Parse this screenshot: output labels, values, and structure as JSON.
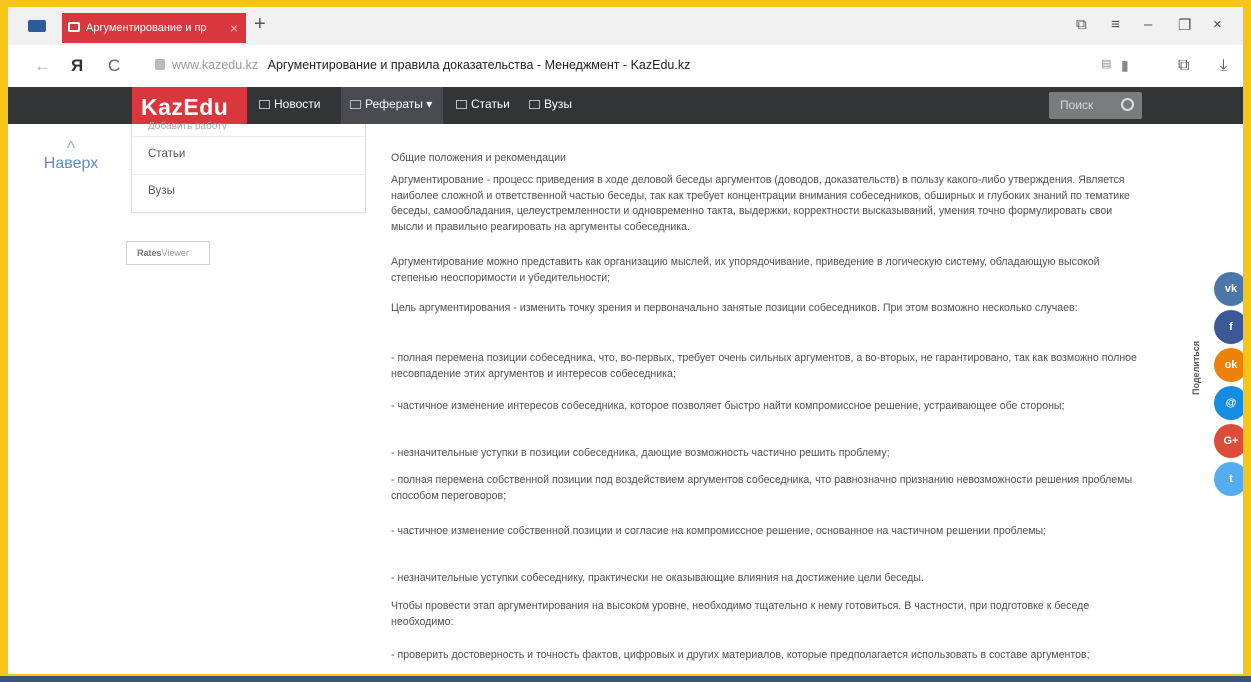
{
  "browser": {
    "tab_title": "Аргументирование и пр",
    "tab_close": "×",
    "new_tab": "+",
    "back": "←",
    "yandex_logo": "Я",
    "reload": "C",
    "url_domain": "www.kazedu.kz",
    "page_title": "Аргументирование и правила доказательства - Менеджмент - KazEdu.kz",
    "window_controls": {
      "minimize": "–",
      "maximize": "❐",
      "close": "×",
      "menu": "≡",
      "bookmarks": "⧉"
    },
    "download": "⤓"
  },
  "site": {
    "logo": "KazEdu",
    "nav": {
      "news": "Новости",
      "essays": "Рефераты ▾",
      "articles": "Статьи",
      "universities": "Вузы"
    },
    "search_placeholder": "Поиск"
  },
  "sidebar": {
    "up_label": "Наверх",
    "up_arrow": "^",
    "cut_item": "Добавить работу",
    "items": [
      {
        "label": "Статьи"
      },
      {
        "label": "Вузы"
      }
    ],
    "widget": {
      "bold": "Rates",
      "rest": "Viewer"
    }
  },
  "article": {
    "paragraphs": [
      "Общие положения и рекомендации",
      "Аргументирование - процесс приведения в ходе деловой беседы аргументов (доводов, доказательств) в пользу какого-либо утверждения. Является наиболее сложной и ответственной частью беседы, так как требует концентрации внимания собеседников, обширных и глубоких знаний по тематике беседы, самообладания, целеустремленности и одновременно такта, выдержки, корректности высказываний, умения точно формулировать свои мысли и правильно реагировать на аргументы собеседника.",
      "Аргументирование можно представить как организацию мыслей, их упорядочивание, приведение в логическую систему, обладающую высокой степенью неоспоримости и убедительности;",
      "Цель аргументирования - изменить точку зрения и первоначально занятые позиции собеседников. При этом возможно несколько случаев:",
      "- полная перемена позиции собеседника, что, во-первых, требует очень сильных аргументов, а во-вторых, не гарантировано, так как возможно полное несовпадение этих аргументов и интересов собеседника;",
      "- частичное изменение интересов собеседника, которое позволяет быстро найти компромиссное решение, устраивающее обе стороны;",
      "- незначительные уступки в позиции собеседника, дающие возможность частично решить проблему;",
      "- полная перемена собственной позиции под воздействием аргументов собеседника, что равнозначно признанию невозможности решения проблемы способом переговоров;",
      "- частичное изменение собственной позиции и согласие на компромиссное решение, основанное на частичном решении проблемы;",
      "- незначительные уступки собеседнику, практически не оказывающие влияния на достижение цели беседы.",
      "Чтобы провести этап аргументирования на высоком уровне, необходимо тщательно к нему готовиться. В частности, при подготовке к беседе необходимо:",
      "- проверить достоверность и точность фактов, цифровых и других материалов, которые предполагается использовать в составе аргументов;"
    ]
  },
  "share": {
    "label": "Поделиться",
    "buttons": [
      {
        "name": "vk",
        "glyph": "vk",
        "color": "#4a76a8"
      },
      {
        "name": "facebook",
        "glyph": "f",
        "color": "#3b5998"
      },
      {
        "name": "odnoklassniki",
        "glyph": "ok",
        "color": "#ee8208"
      },
      {
        "name": "mail",
        "glyph": "@",
        "color": "#168de2"
      },
      {
        "name": "google-plus",
        "glyph": "G+",
        "color": "#dd4b39"
      },
      {
        "name": "twitter",
        "glyph": "t",
        "color": "#55acee"
      }
    ]
  }
}
